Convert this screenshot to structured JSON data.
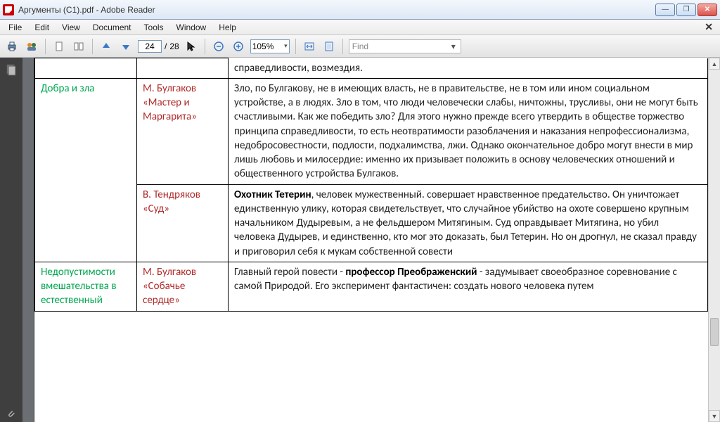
{
  "window": {
    "title": "Аргументы (С1).pdf - Adobe Reader",
    "minimize": "—",
    "maximize": "❐",
    "close": "✕"
  },
  "menu": {
    "items": [
      "File",
      "Edit",
      "View",
      "Document",
      "Tools",
      "Window",
      "Help"
    ],
    "close_doc": "✕"
  },
  "toolbar": {
    "page_current": "24",
    "page_sep": "/",
    "page_total": "28",
    "zoom": "105%",
    "find_placeholder": "Find"
  },
  "doc": {
    "top_fragment": "справедливости, возмездия.",
    "rows": [
      {
        "topic": "Добра и зла",
        "author": "М. Булгаков «Мастер и Маргарита»",
        "text_html": "Зло, по Булгакову, не в имеющих власть, не в правительстве, не в том или ином социальном устройстве, а в людях. Зло в том, что люди человечески слабы, ничтожны, трусливы, они не могут быть счастливыми. Как же победить зло? Для этого нужно прежде всего утвердить в обществе торжество принципа справедливости, то есть неотвратимости разоблачения и наказания непрофессионализма, недобросовестности, подлости, подхалимства, лжи. Однако окончательное добро могут внести в мир лишь любовь и милосердие: именно их призывает положить в основу человеческих отношений и общественного устройства Булгаков."
      },
      {
        "topic": "",
        "author": "В. Тендряков «Суд»",
        "text_html": "<b>Охотник Тетерин</b>, человек мужественный. совершает нравственное предательство. Он уничтожает единственную улику, которая свидетельствует, что случайное убийство на охоте совершено крупным начальником Дудыревым, а не фельдшером Митягиным. Суд оправдывает Митягина, но убил человека Дудырев, и единственно, кто мог это доказать, был Тетерин. Но он дрогнул, не сказал правду и приговорил себя к мукам собственной совести"
      },
      {
        "topic": "Недопустимости вмешательства в естественный",
        "author": "М. Булгаков «Собачье сердце»",
        "text_html": "Главный герой повести - <b>профессор Преображенский</b> - задумывает своеобразное соревнование с самой Природой. Его эксперимент фантастичен: создать нового человека путем"
      }
    ]
  }
}
